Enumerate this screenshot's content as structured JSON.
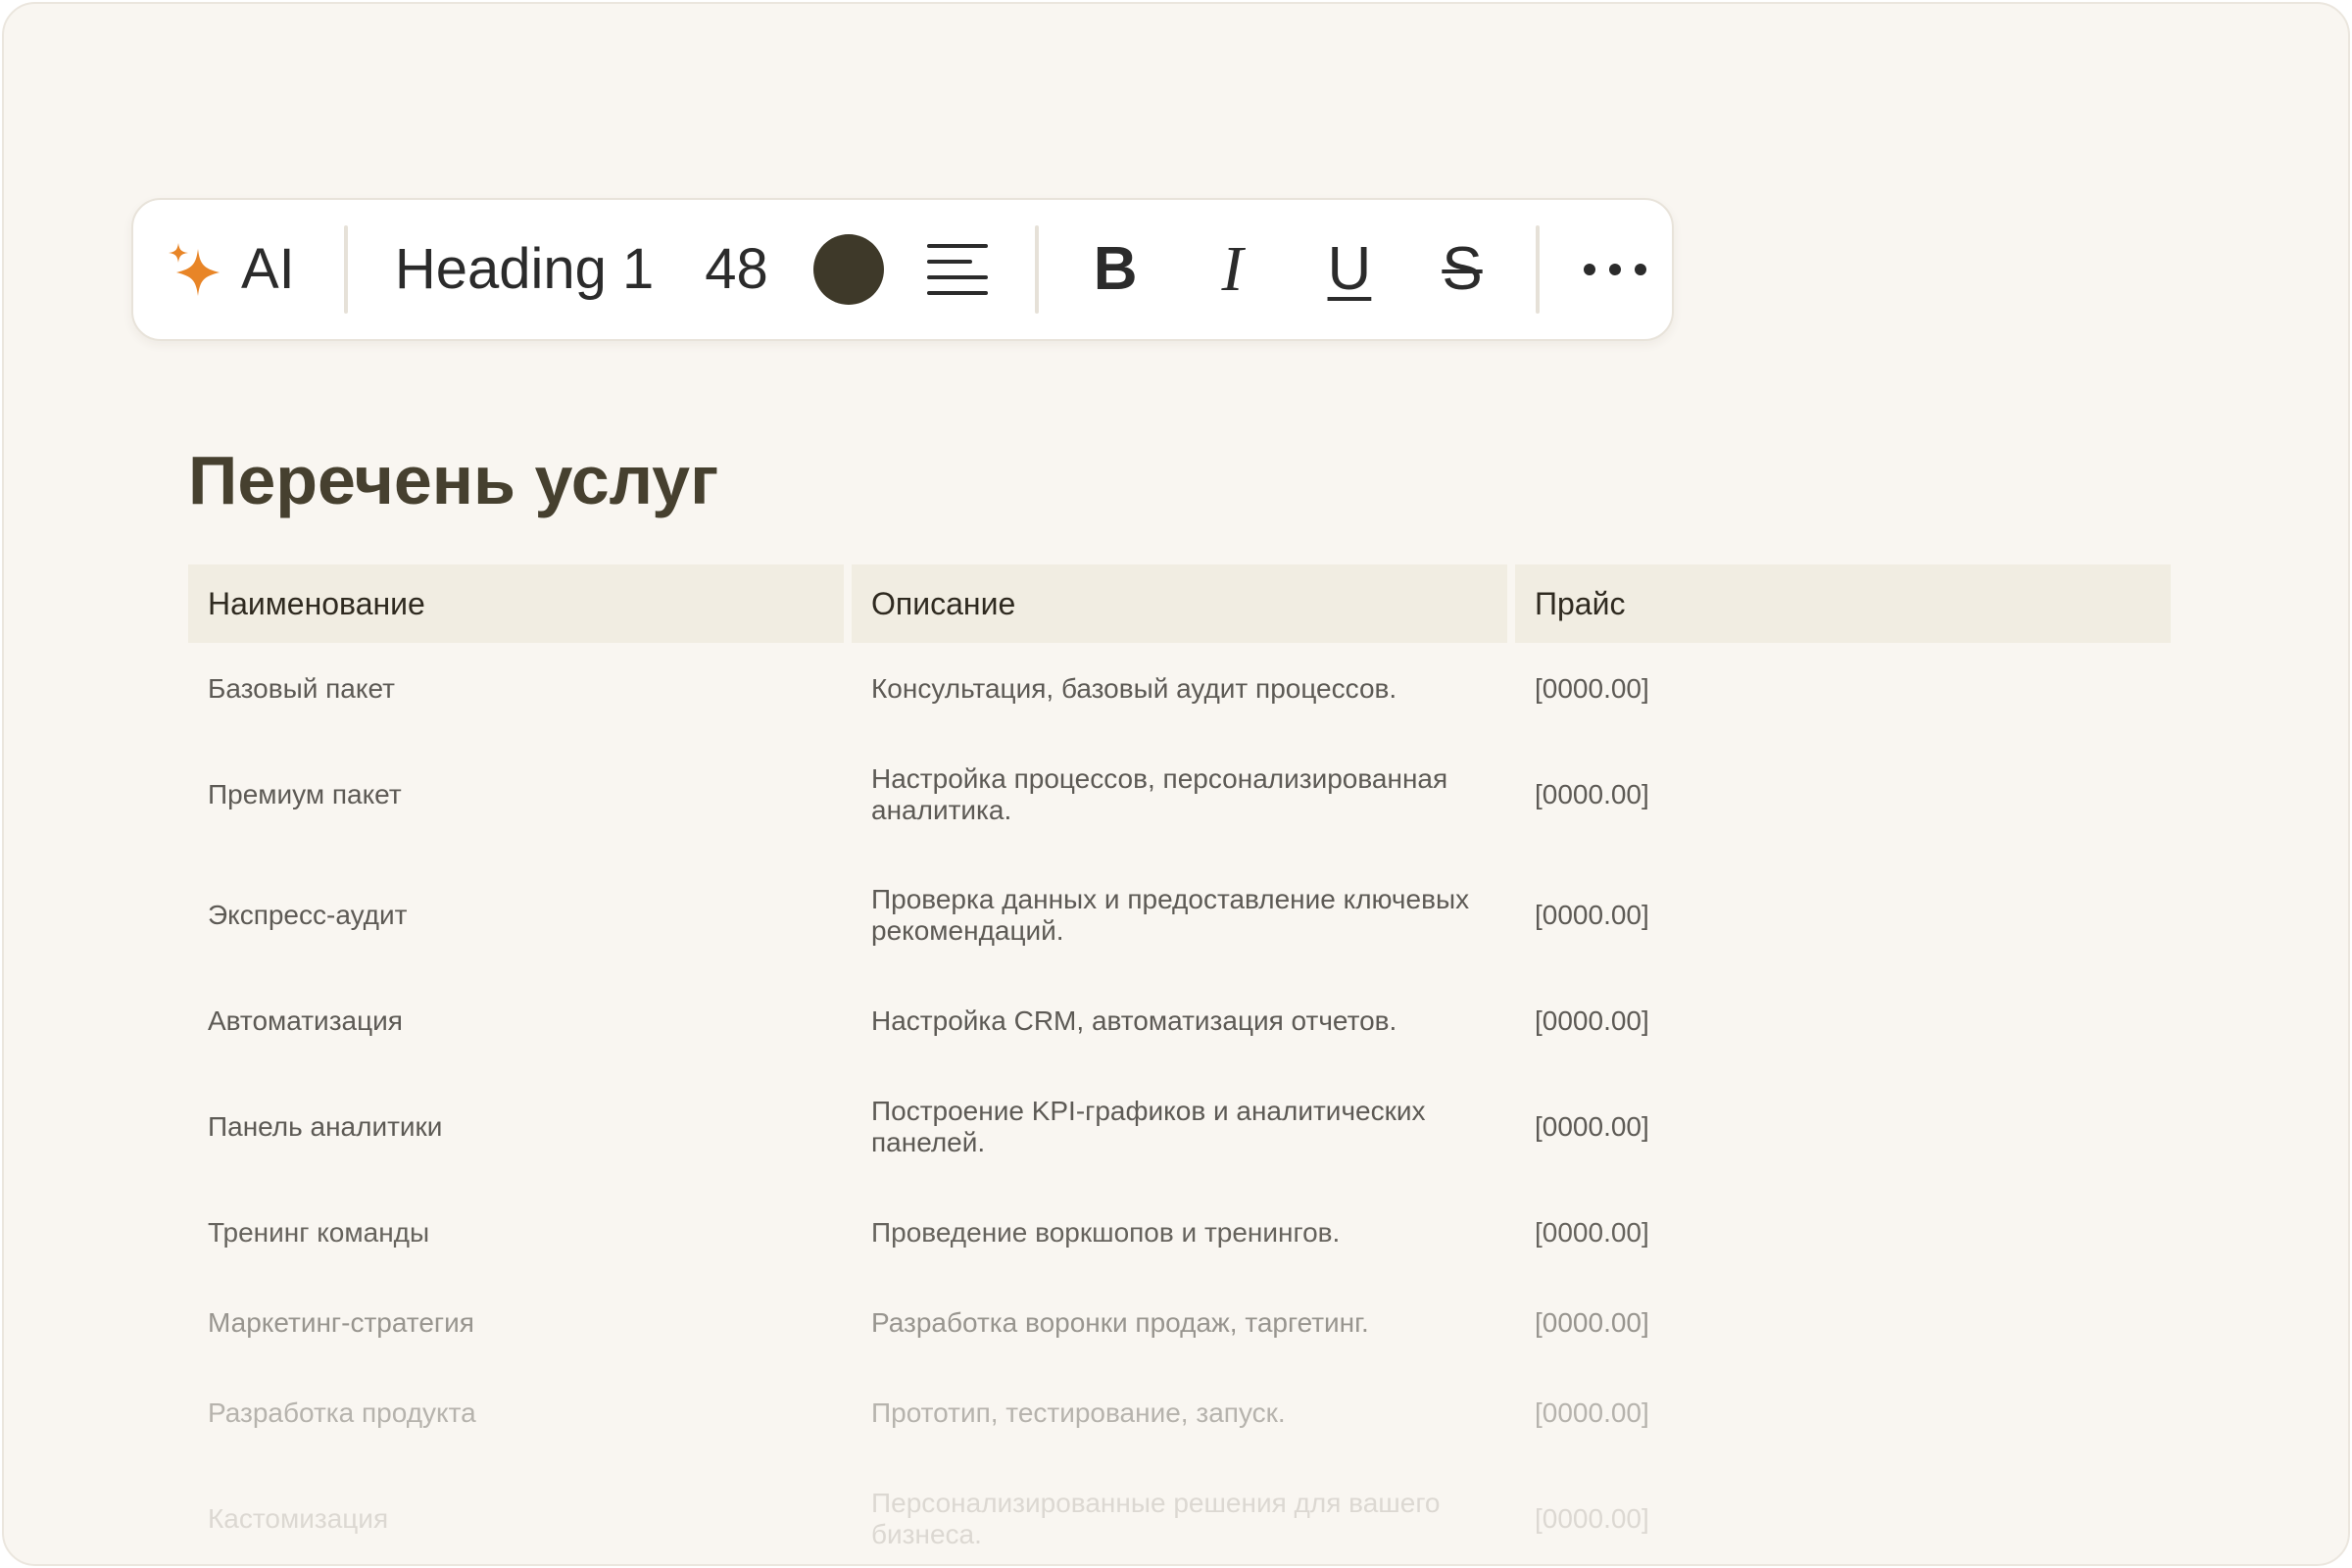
{
  "toolbar": {
    "ai_label": "AI",
    "ai_icon": "sparkle-icon",
    "ai_icon_color": "#e88527",
    "style_label": "Heading 1",
    "size_label": "48",
    "text_color": "#3e3929",
    "align_icon": "align-left-icon",
    "bold_label": "B",
    "italic_label": "I",
    "underline_label": "U",
    "strike_label": "S",
    "more_icon": "more-horizontal-icon"
  },
  "page": {
    "title": "Перечень услуг"
  },
  "table": {
    "headers": [
      "Наименование",
      "Описание",
      "Прайс"
    ],
    "rows": [
      {
        "name": "Базовый пакет",
        "description": "Консультация, базовый аудит процессов.",
        "price": "[0000.00]"
      },
      {
        "name": "Премиум пакет",
        "description": "Настройка процессов, персонализированная аналитика.",
        "price": "[0000.00]"
      },
      {
        "name": "Экспресс-аудит",
        "description": "Проверка данных и предоставление ключевых рекомендаций.",
        "price": "[0000.00]"
      },
      {
        "name": "Автоматизация",
        "description": "Настройка CRM, автоматизация отчетов.",
        "price": "[0000.00]"
      },
      {
        "name": "Панель аналитики",
        "description": "Построение KPI-графиков и аналитических панелей.",
        "price": "[0000.00]"
      },
      {
        "name": "Тренинг команды",
        "description": "Проведение воркшопов и тренингов.",
        "price": "[0000.00]"
      },
      {
        "name": "Маркетинг-стратегия",
        "description": "Разработка воронки продаж, таргетинг.",
        "price": "[0000.00]"
      },
      {
        "name": "Разработка продукта",
        "description": "Прототип, тестирование, запуск.",
        "price": "[0000.00]"
      },
      {
        "name": "Кастомизация",
        "description": "Персонализированные решения для вашего бизнеса.",
        "price": "[0000.00]"
      }
    ]
  }
}
